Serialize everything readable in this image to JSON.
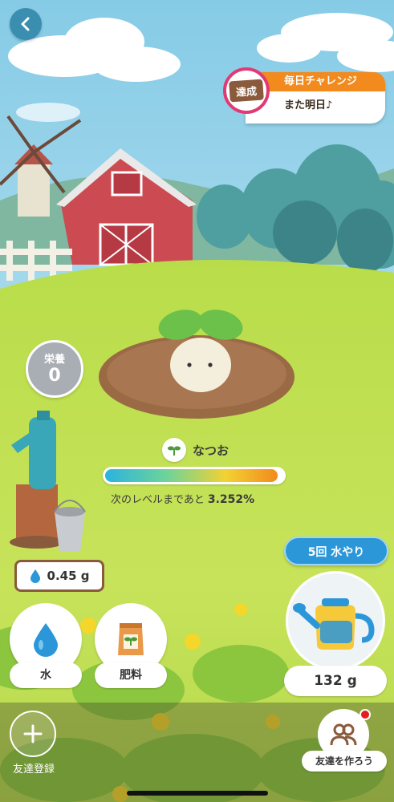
{
  "challenge": {
    "title": "毎日チャレンジ",
    "status": "また明日♪",
    "badge": "達成"
  },
  "nutrition": {
    "label": "栄養",
    "value": "0"
  },
  "plant": {
    "name": "なつお",
    "level_text": "次のレベルまであと",
    "level_percent": "3.252%",
    "progress": 0.97
  },
  "water_amount": "0.45 g",
  "buttons": {
    "water": "水",
    "fertilizer": "肥料",
    "water_5x": "5回 水やり",
    "can_amount": "132 g"
  },
  "bottom": {
    "add_friend": "友達登録",
    "make_friends": "友達を作ろう"
  },
  "colors": {
    "accent_orange": "#f28a1d",
    "badge_pink": "#e03a74",
    "button_blue": "#2b97d9"
  }
}
